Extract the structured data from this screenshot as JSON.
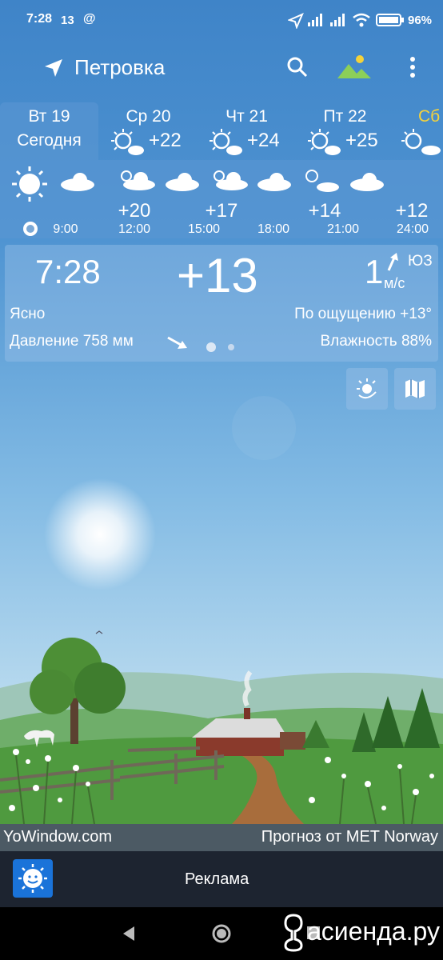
{
  "status": {
    "time": "7:28",
    "temp_small": "13",
    "at": "@",
    "battery": "96%"
  },
  "header": {
    "location": "Петровка"
  },
  "days": [
    {
      "label": "Вт 19",
      "sub": "Сегодня",
      "active": true
    },
    {
      "label": "Ср 20",
      "temp": "+22"
    },
    {
      "label": "Чт 21",
      "temp": "+24"
    },
    {
      "label": "Пт 22",
      "temp": "+25"
    },
    {
      "label": "Сб"
    }
  ],
  "hourly": {
    "times": [
      "9:00",
      "12:00",
      "15:00",
      "18:00",
      "21:00",
      "24:00"
    ],
    "temps": [
      "+20",
      "+17",
      "+14",
      "+12"
    ]
  },
  "current": {
    "time": "7:28",
    "temp": "+13",
    "wind_speed": "1",
    "wind_unit": "м/с",
    "wind_dir": "ЮЗ",
    "condition": "Ясно",
    "feels_like": "По ощущению +13°",
    "pressure": "Давление 758 мм",
    "humidity": "Влажность 88%"
  },
  "footer": {
    "brand": "YoWindow.com",
    "credit": "Прогноз от MET Norway"
  },
  "ad": {
    "label": "Реклама"
  },
  "watermark": "асиенда.ру"
}
